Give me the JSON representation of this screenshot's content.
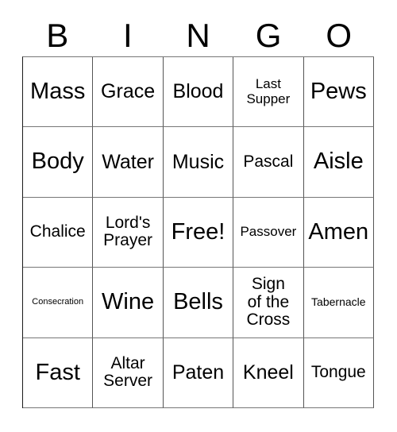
{
  "card": {
    "title_letters": [
      "B",
      "I",
      "N",
      "G",
      "O"
    ],
    "columns": 5,
    "rows": 5,
    "free_space_label": "Free!",
    "colors": {
      "background": "#ffffff",
      "text": "#000000",
      "grid_line": "#666666"
    },
    "cells": [
      [
        {
          "label": "Mass",
          "size": "xxl"
        },
        {
          "label": "Grace",
          "size": "xl"
        },
        {
          "label": "Blood",
          "size": "xl"
        },
        {
          "label": "Last\nSupper",
          "size": "md"
        },
        {
          "label": "Pews",
          "size": "xxl"
        }
      ],
      [
        {
          "label": "Body",
          "size": "xxl"
        },
        {
          "label": "Water",
          "size": "xl"
        },
        {
          "label": "Music",
          "size": "xl"
        },
        {
          "label": "Pascal",
          "size": "lg"
        },
        {
          "label": "Aisle",
          "size": "xxl"
        }
      ],
      [
        {
          "label": "Chalice",
          "size": "lg"
        },
        {
          "label": "Lord's\nPrayer",
          "size": "lg"
        },
        {
          "label": "Free!",
          "size": "xxl"
        },
        {
          "label": "Passover",
          "size": "md"
        },
        {
          "label": "Amen",
          "size": "xxl"
        }
      ],
      [
        {
          "label": "Consecration",
          "size": "xs"
        },
        {
          "label": "Wine",
          "size": "xxl"
        },
        {
          "label": "Bells",
          "size": "xxl"
        },
        {
          "label": "Sign\nof the\nCross",
          "size": "lg"
        },
        {
          "label": "Tabernacle",
          "size": "sm"
        }
      ],
      [
        {
          "label": "Fast",
          "size": "xxl"
        },
        {
          "label": "Altar\nServer",
          "size": "lg"
        },
        {
          "label": "Paten",
          "size": "xl"
        },
        {
          "label": "Kneel",
          "size": "xl"
        },
        {
          "label": "Tongue",
          "size": "lg"
        }
      ]
    ]
  }
}
